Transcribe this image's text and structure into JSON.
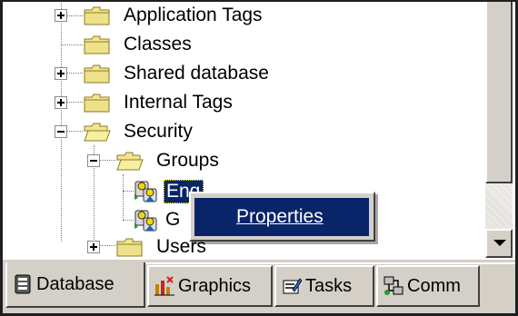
{
  "tree": {
    "items": [
      {
        "label": "Application Tags",
        "expander": "plus"
      },
      {
        "label": "Classes",
        "expander": "none"
      },
      {
        "label": "Shared database",
        "expander": "plus"
      },
      {
        "label": "Internal Tags",
        "expander": "plus"
      },
      {
        "label": "Security",
        "expander": "minus"
      },
      {
        "label": "Groups",
        "expander": "minus"
      },
      {
        "label": "Eng",
        "expander": "none"
      },
      {
        "label": "G",
        "expander": "none"
      },
      {
        "label": "Users",
        "expander": "plus"
      }
    ]
  },
  "context_menu": {
    "items": [
      {
        "label": "Properties"
      }
    ]
  },
  "tabs": [
    {
      "label": "Database",
      "icon": "database-icon",
      "active": true
    },
    {
      "label": "Graphics",
      "icon": "graphics-icon",
      "active": false
    },
    {
      "label": "Tasks",
      "icon": "tasks-icon",
      "active": false
    },
    {
      "label": "Comm",
      "icon": "comm-icon",
      "active": false
    }
  ],
  "colors": {
    "folder": "#f2e58c",
    "selection": "#0a246a",
    "face": "#d4d0c8"
  }
}
